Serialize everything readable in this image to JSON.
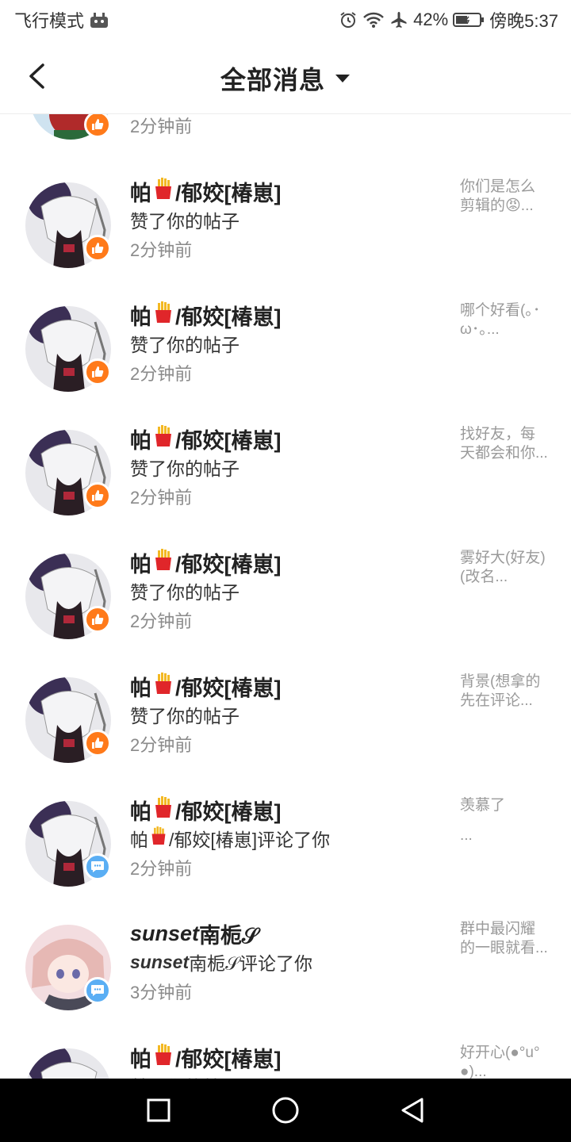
{
  "status_bar": {
    "mode": "飞行模式",
    "battery": "42%",
    "time": "傍晚5:37",
    "icons": [
      "android-icon",
      "alarm-icon",
      "wifi-icon",
      "airplane-icon",
      "battery-icon"
    ]
  },
  "header": {
    "title": "全部消息"
  },
  "first_partial": {
    "time": "2分钟前"
  },
  "items": [
    {
      "name_a": "帕",
      "name_b": "/郁姣[椿崽]",
      "action": "赞了你的帖子",
      "time": "2分钟前",
      "snippet": "你们是怎么剪辑的😡...",
      "type": "like"
    },
    {
      "name_a": "帕",
      "name_b": "/郁姣[椿崽]",
      "action": "赞了你的帖子",
      "time": "2分钟前",
      "snippet": "哪个好看(｡･ω･｡...",
      "type": "like"
    },
    {
      "name_a": "帕",
      "name_b": "/郁姣[椿崽]",
      "action": "赞了你的帖子",
      "time": "2分钟前",
      "snippet": "找好友，每天都会和你...",
      "type": "like"
    },
    {
      "name_a": "帕",
      "name_b": "/郁姣[椿崽]",
      "action": "赞了你的帖子",
      "time": "2分钟前",
      "snippet": "雾好大(好友)(改名...",
      "type": "like"
    },
    {
      "name_a": "帕",
      "name_b": "/郁姣[椿崽]",
      "action": "赞了你的帖子",
      "time": "2分钟前",
      "snippet": "背景(想拿的先在评论...",
      "type": "like"
    },
    {
      "name_a": "帕",
      "name_b": "/郁姣[椿崽]",
      "action_a": "帕",
      "action_b": "/郁姣[椿崽]评论了你",
      "time": "2分钟前",
      "snippet": "羡慕了",
      "snippet2": "...",
      "type": "comment"
    },
    {
      "name_a": "sunset",
      "name_b": "南栀𝒮",
      "action_a": "sunset",
      "action_b": "南栀𝒮评论了你",
      "time": "3分钟前",
      "snippet": "群中最闪耀的一眼就看...",
      "type": "comment"
    },
    {
      "name_a": "帕",
      "name_b": "/郁姣[椿崽]",
      "action": "赞了你的帖子",
      "snippet": "好开心(●°u°●)...",
      "type": "like"
    }
  ],
  "colors": {
    "like_badge": "#ff7a1a",
    "comment_badge": "#5aaef4",
    "nav_bar": "#000000"
  },
  "nav": {
    "icons": [
      "recent-apps-icon",
      "home-icon",
      "back-icon"
    ]
  }
}
